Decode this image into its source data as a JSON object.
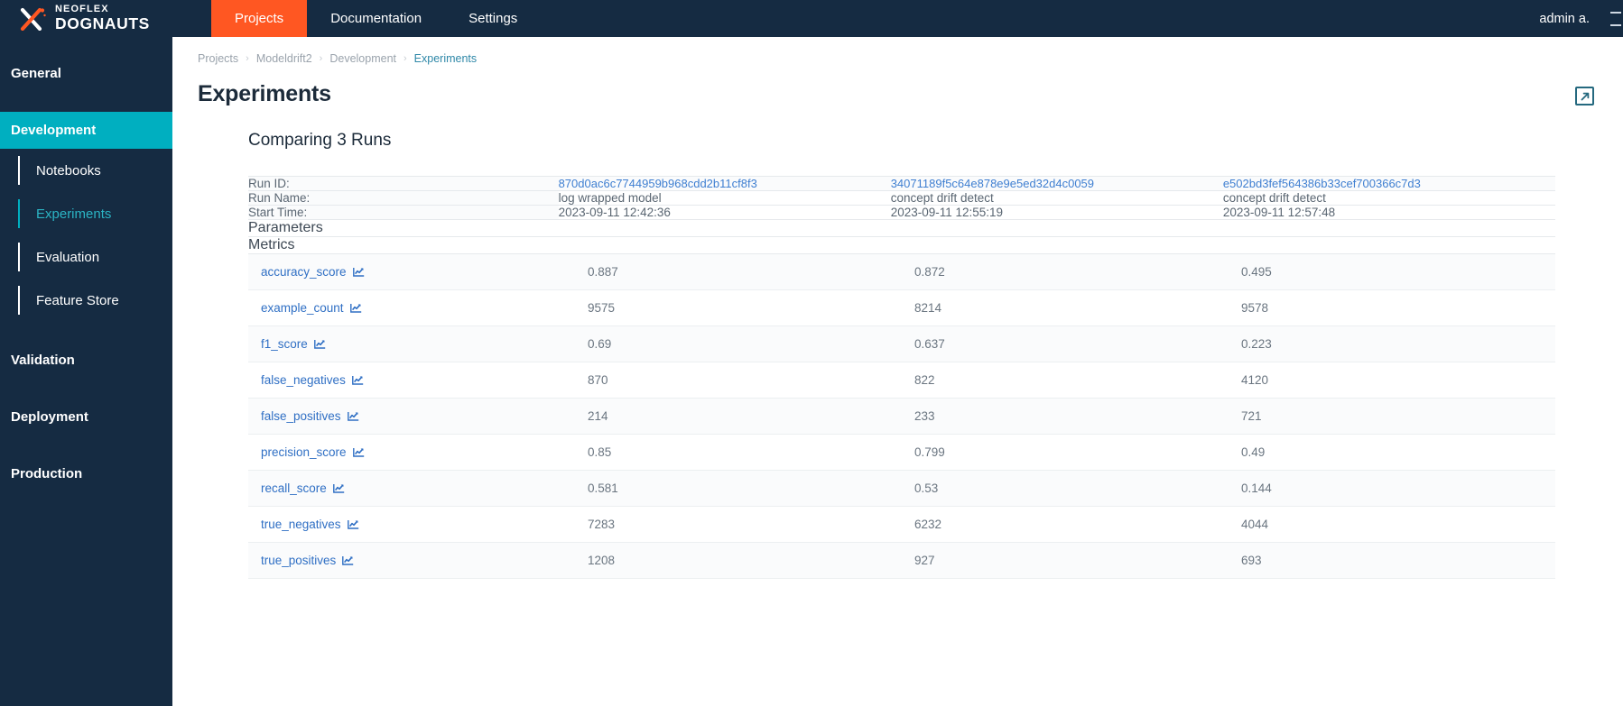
{
  "brand": {
    "line1": "NEOFLEX",
    "line2": "DOGNAUTS",
    "logo_icon": "neoflex-x-logo"
  },
  "topnav": {
    "items": [
      {
        "label": "Projects",
        "active": true
      },
      {
        "label": "Documentation",
        "active": false
      },
      {
        "label": "Settings",
        "active": false
      }
    ],
    "user": "admin a.",
    "logout_icon": "logout-icon"
  },
  "sidebar": {
    "sections": [
      {
        "label": "General",
        "active": false
      },
      {
        "label": "Development",
        "active": true
      },
      {
        "label": "Validation",
        "active": false
      },
      {
        "label": "Deployment",
        "active": false
      },
      {
        "label": "Production",
        "active": false
      }
    ],
    "subitems": [
      {
        "label": "Notebooks",
        "selected": false
      },
      {
        "label": "Experiments",
        "selected": true
      },
      {
        "label": "Evaluation",
        "selected": false
      },
      {
        "label": "Feature Store",
        "selected": false
      }
    ]
  },
  "breadcrumb": {
    "items": [
      "Projects",
      "Modeldrift2",
      "Development",
      "Experiments"
    ],
    "separator": "›"
  },
  "page": {
    "title": "Experiments",
    "external_link_icon": "open-in-new-icon",
    "compare_title": "Comparing 3 Runs"
  },
  "runs": {
    "labels": {
      "run_id": "Run ID:",
      "run_name": "Run Name:",
      "start_time": "Start Time:"
    },
    "ids": [
      "870d0ac6c7744959b968cdd2b11cf8f3",
      "34071189f5c64e878e9e5ed32d4c0059",
      "e502bd3fef564386b33cef700366c7d3"
    ],
    "names": [
      "log wrapped model",
      "concept drift detect",
      "concept drift detect"
    ],
    "start_times": [
      "2023-09-11 12:42:36",
      "2023-09-11 12:55:19",
      "2023-09-11 12:57:48"
    ]
  },
  "sections": {
    "parameters": "Parameters",
    "metrics": "Metrics"
  },
  "metrics": [
    {
      "name": "accuracy_score",
      "icon": "line-chart-icon",
      "values": [
        "0.887",
        "0.872",
        "0.495"
      ]
    },
    {
      "name": "example_count",
      "icon": "line-chart-icon",
      "values": [
        "9575",
        "8214",
        "9578"
      ]
    },
    {
      "name": "f1_score",
      "icon": "line-chart-icon",
      "values": [
        "0.69",
        "0.637",
        "0.223"
      ]
    },
    {
      "name": "false_negatives",
      "icon": "line-chart-icon",
      "values": [
        "870",
        "822",
        "4120"
      ]
    },
    {
      "name": "false_positives",
      "icon": "line-chart-icon",
      "values": [
        "214",
        "233",
        "721"
      ]
    },
    {
      "name": "precision_score",
      "icon": "line-chart-icon",
      "values": [
        "0.85",
        "0.799",
        "0.49"
      ]
    },
    {
      "name": "recall_score",
      "icon": "line-chart-icon",
      "values": [
        "0.581",
        "0.53",
        "0.144"
      ]
    },
    {
      "name": "true_negatives",
      "icon": "line-chart-icon",
      "values": [
        "7283",
        "6232",
        "4044"
      ]
    },
    {
      "name": "true_positives",
      "icon": "line-chart-icon",
      "values": [
        "1208",
        "927",
        "693"
      ]
    }
  ],
  "colors": {
    "navy": "#152b42",
    "orange": "#ff5722",
    "teal": "#00afc0",
    "link_blue": "#3f7fd1",
    "metric_blue": "#2f6fc4"
  }
}
